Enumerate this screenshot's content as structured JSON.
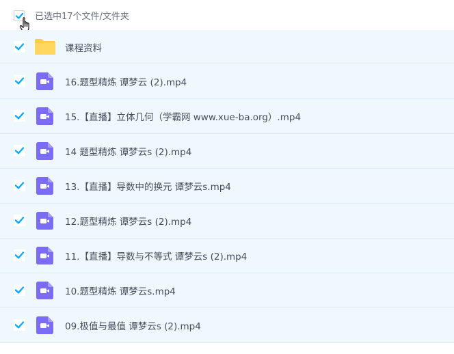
{
  "header": {
    "selection_text": "已选中17个文件/文件夹",
    "checked": true
  },
  "colors": {
    "row_bg": "#eff8fd",
    "checkbox_blue": "#09aaff",
    "video_icon_purple": "#7b6cf6",
    "folder_yellow": "#ffce4a",
    "text": "#454d5a"
  },
  "items": [
    {
      "name": "课程资料",
      "type": "folder-icon",
      "checked": true
    },
    {
      "name": "16.题型精炼 谭梦云 (2).mp4",
      "type": "video-file-icon",
      "checked": true
    },
    {
      "name": "15.【直播】立体几何（学霸网 www.xue-ba.org）.mp4",
      "type": "video-file-icon",
      "checked": true
    },
    {
      "name": "14 题型精炼 谭梦云s (2).mp4",
      "type": "video-file-icon",
      "checked": true
    },
    {
      "name": "13.【直播】导数中的换元 谭梦云s.mp4",
      "type": "video-file-icon",
      "checked": true
    },
    {
      "name": "12.题型精炼 谭梦云s (2).mp4",
      "type": "video-file-icon",
      "checked": true
    },
    {
      "name": "11.【直播】导数与不等式 谭梦云s (2).mp4",
      "type": "video-file-icon",
      "checked": true
    },
    {
      "name": "10.题型精炼 谭梦云s.mp4",
      "type": "video-file-icon",
      "checked": true
    },
    {
      "name": "09.极值与最值 谭梦云s (2).mp4",
      "type": "video-file-icon",
      "checked": true
    }
  ]
}
